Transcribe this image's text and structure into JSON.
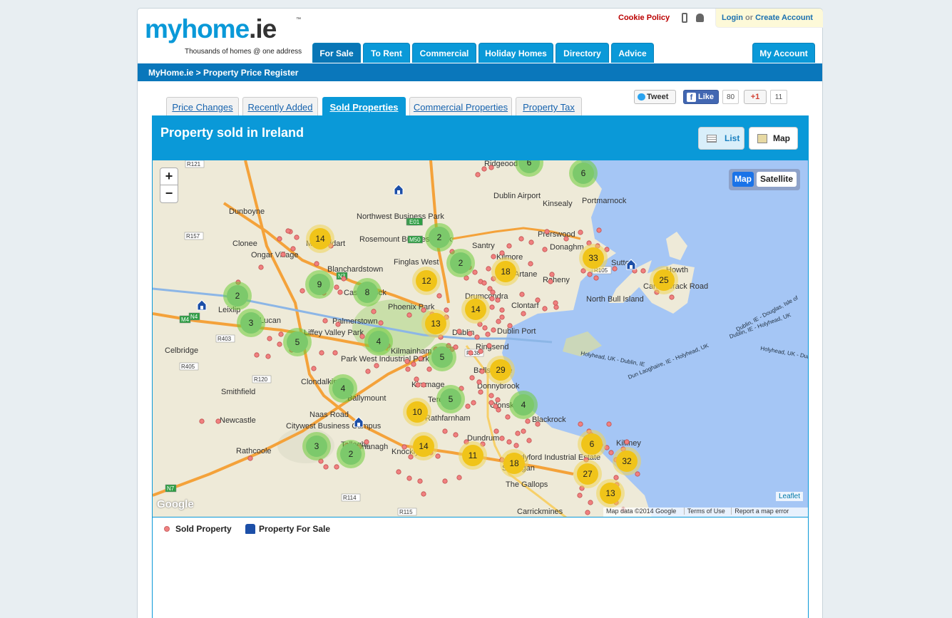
{
  "header": {
    "logo_text_main": "myhome",
    "logo_text_tld": ".ie",
    "logo_tm": "™",
    "tagline": "Thousands of homes @ one address",
    "cookie_policy": "Cookie Policy",
    "login": "Login",
    "or": "or",
    "create_account": "Create Account"
  },
  "nav": {
    "tabs": [
      {
        "label": "For Sale",
        "active": true
      },
      {
        "label": "To Rent"
      },
      {
        "label": "Commercial"
      },
      {
        "label": "Holiday Homes"
      },
      {
        "label": "Directory"
      },
      {
        "label": "Advice"
      }
    ],
    "my_account": "My Account"
  },
  "breadcrumb": "MyHome.ie > Property Price Register",
  "subtabs": [
    {
      "label": "Price Changes"
    },
    {
      "label": "Recently Added"
    },
    {
      "label": "Sold Properties",
      "active": true
    },
    {
      "label": "Commercial Properties"
    },
    {
      "label": "Property Tax"
    }
  ],
  "share": {
    "tweet": "Tweet",
    "like": "Like",
    "like_count": "80",
    "gplus": "+1",
    "gplus_count": "11"
  },
  "panel": {
    "title": "Property sold in Ireland",
    "list_label": "List",
    "map_label": "Map"
  },
  "map": {
    "zoom_in": "+",
    "zoom_out": "−",
    "type_map": "Map",
    "type_satellite": "Satellite",
    "leaflet": "Leaflet",
    "google": "Google",
    "map_data": "Map data ©2014 Google",
    "terms": "Terms of Use",
    "report": "Report a map error",
    "places": [
      "Ridgeood",
      "Dublin Airport",
      "Kinsealy",
      "Portmarnock",
      "Dunboyne",
      "Northwest Business Park",
      "Rosemount Business Park",
      "Mulhuddart",
      "Clonee",
      "Ongar Village",
      "Blanchardstown",
      "Finglas West",
      "Santry",
      "Kilmore",
      "Prerswood",
      "Donaghm",
      "Artane",
      "Raheny",
      "Sutton",
      "Howth",
      "Carrickbrack Road",
      "North Bull Island",
      "Castleknock",
      "Drumcondra",
      "Clontarf",
      "Leixlip",
      "Lucan",
      "Phoenix Park",
      "Liffey Valley Park",
      "Palmerstown",
      "Dublin",
      "Dublin Port",
      "Celbridge",
      "Kilmainham",
      "Ringsend",
      "Park West Industrial Park",
      "Ballsbridge",
      "Smithfield",
      "Clondalkin",
      "Kimmage",
      "Donnybrook",
      "Ballymount",
      "Terenure",
      "Clonskeagh",
      "Blackrock",
      "Newcastle",
      "Citywest Business Campus",
      "Kilnamanagh",
      "Rathfarnham",
      "Rathcoole",
      "Tallaght",
      "Knocklyon",
      "Dundrum",
      "Sandyford Industrial Estate",
      "Stillorgan",
      "Killiney",
      "The Gallops",
      "Carrickmines",
      "Holyhead, UK - Dublin, IE",
      "Dublin, IE - Holyhead, UK",
      "Dun Laoghaire, IE - Holyhead, UK",
      "Holyhead, UK - Dun",
      "Dublin, IE - Douglas, Isle of",
      "R121",
      "R157",
      "R403",
      "R405",
      "R120",
      "R114",
      "R115",
      "R138",
      "R105",
      "N3",
      "N2",
      "N4",
      "N7",
      "M50",
      "E01",
      "M4",
      "Naas Road"
    ],
    "clusters": [
      {
        "n": "6",
        "c": "green"
      },
      {
        "n": "6",
        "c": "green"
      },
      {
        "n": "14",
        "c": "yellow"
      },
      {
        "n": "2",
        "c": "green"
      },
      {
        "n": "2",
        "c": "green"
      },
      {
        "n": "33",
        "c": "yellow"
      },
      {
        "n": "25",
        "c": "yellow"
      },
      {
        "n": "12",
        "c": "yellow"
      },
      {
        "n": "18",
        "c": "yellow"
      },
      {
        "n": "9",
        "c": "green"
      },
      {
        "n": "8",
        "c": "green"
      },
      {
        "n": "2",
        "c": "green"
      },
      {
        "n": "14",
        "c": "yellow"
      },
      {
        "n": "3",
        "c": "green"
      },
      {
        "n": "13",
        "c": "yellow"
      },
      {
        "n": "5",
        "c": "green"
      },
      {
        "n": "4",
        "c": "green"
      },
      {
        "n": "5",
        "c": "green"
      },
      {
        "n": "29",
        "c": "yellow"
      },
      {
        "n": "4",
        "c": "green"
      },
      {
        "n": "5",
        "c": "green"
      },
      {
        "n": "10",
        "c": "yellow"
      },
      {
        "n": "4",
        "c": "green"
      },
      {
        "n": "3",
        "c": "green"
      },
      {
        "n": "2",
        "c": "green"
      },
      {
        "n": "14",
        "c": "yellow"
      },
      {
        "n": "11",
        "c": "yellow"
      },
      {
        "n": "18",
        "c": "yellow"
      },
      {
        "n": "6",
        "c": "yellow"
      },
      {
        "n": "32",
        "c": "yellow"
      },
      {
        "n": "27",
        "c": "yellow"
      },
      {
        "n": "13",
        "c": "yellow"
      }
    ]
  },
  "legend": {
    "sold": "Sold Property",
    "for_sale": "Property For Sale"
  },
  "colors": {
    "brand_blue": "#0a99d8",
    "dark_blue": "#0a77bb",
    "sold_dot": "#f08080",
    "cluster_green": "#7cc96b",
    "cluster_yellow": "#f5cb3a",
    "water": "#a5c6f5"
  }
}
